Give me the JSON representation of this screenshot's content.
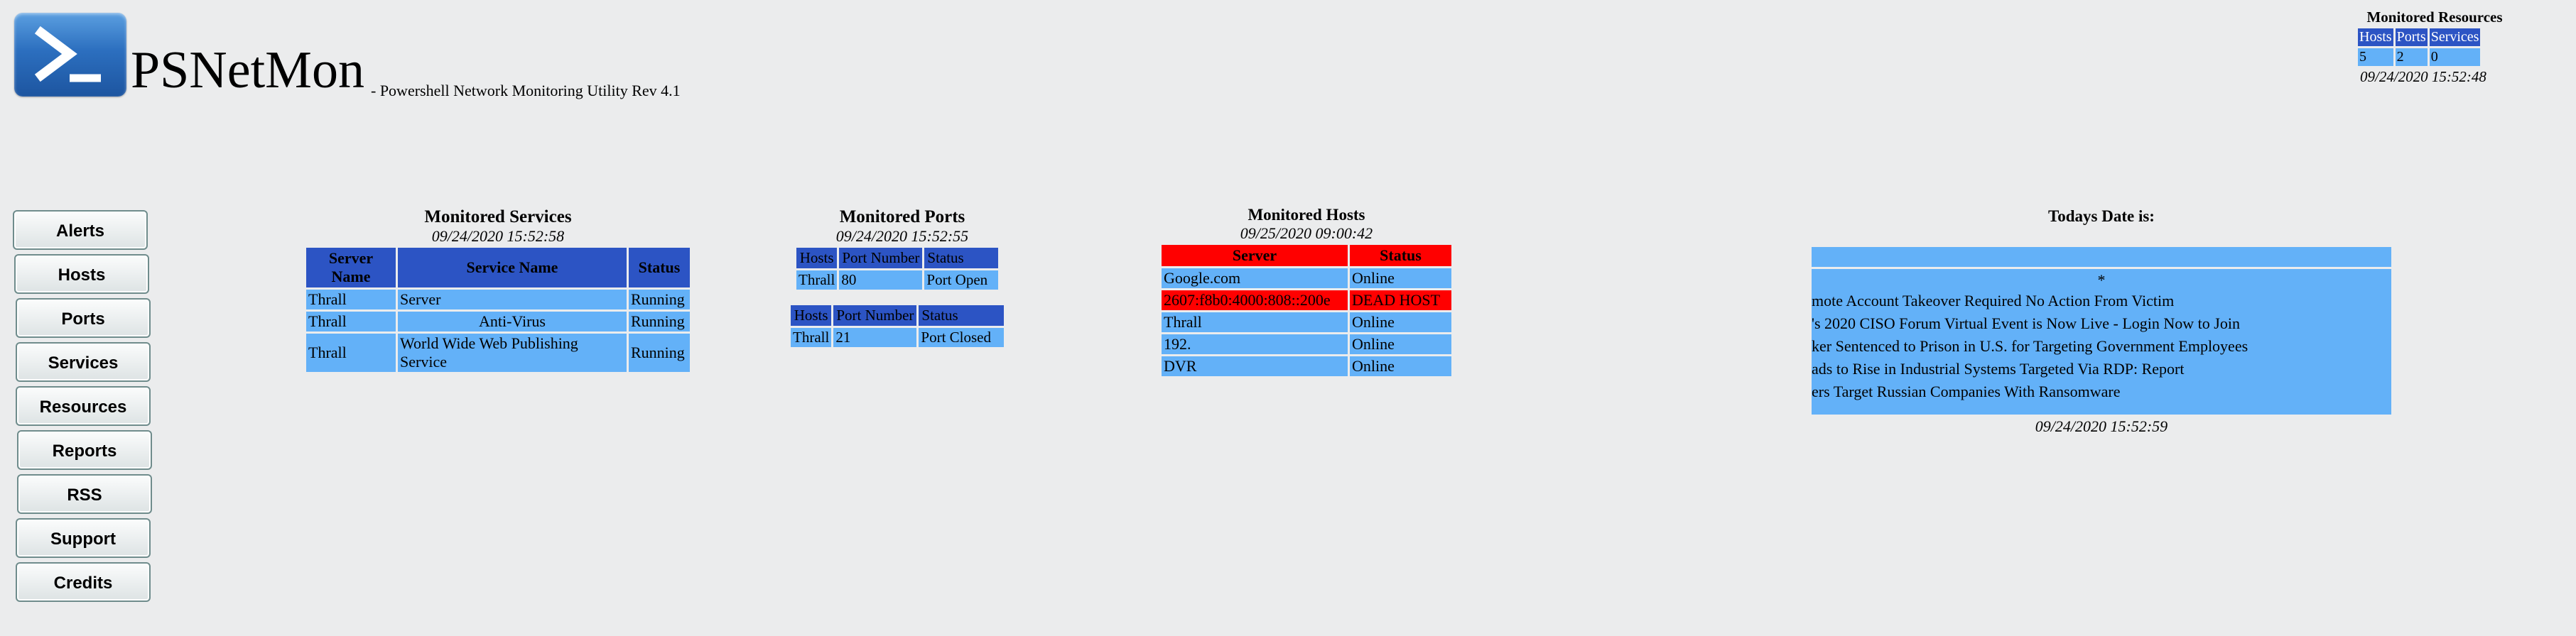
{
  "app": {
    "title": "PSNetMon",
    "subtitle": "- Powershell Network Monitoring Utility Rev 4.1"
  },
  "resources": {
    "title": "Monitored Resources",
    "headers": [
      "Hosts",
      "Ports",
      "Services"
    ],
    "values": [
      "5",
      "2",
      "0"
    ],
    "timestamp": "09/24/2020 15:52:48"
  },
  "nav": {
    "items": [
      "Alerts",
      "Hosts",
      "Ports",
      "Services",
      "Resources",
      "Reports",
      "RSS",
      "Support",
      "Credits"
    ]
  },
  "services": {
    "title": "Monitored Services",
    "timestamp": "09/24/2020 15:52:58",
    "headers": [
      "Server Name",
      "Service Name",
      "Status"
    ],
    "rows": [
      [
        "Thrall",
        "Server",
        "Running"
      ],
      [
        "Thrall",
        "Anti-Virus",
        "Running"
      ],
      [
        "Thrall",
        "World Wide Web Publishing Service",
        "Running"
      ]
    ]
  },
  "ports": {
    "title": "Monitored Ports",
    "timestamp": "09/24/2020 15:52:55",
    "tables": [
      {
        "headers": [
          "Hosts",
          "Port Number",
          "Status"
        ],
        "row": [
          "Thrall",
          "80",
          "Port Open"
        ]
      },
      {
        "headers": [
          "Hosts",
          "Port Number",
          "Status"
        ],
        "row": [
          "Thrall",
          "21",
          "Port Closed"
        ]
      }
    ]
  },
  "hosts": {
    "title": "Monitored Hosts",
    "timestamp": "09/25/2020 09:00:42",
    "headers": [
      "Server",
      "Status"
    ],
    "rows": [
      [
        "Google.com",
        "Online"
      ],
      [
        "2607:f8b0:4000:808::200e",
        "DEAD HOST"
      ],
      [
        "Thrall",
        "Online"
      ],
      [
        "192.",
        "Online"
      ],
      [
        "DVR",
        "Online"
      ]
    ]
  },
  "rss": {
    "title": "Todays Date is:",
    "star": "*",
    "items": [
      "mote Account Takeover Required No Action From Victim",
      "'s 2020 CISO Forum Virtual Event is Now Live - Login Now to Join",
      "ker Sentenced to Prison in U.S. for Targeting Government Employees",
      "ads to Rise in Industrial Systems Targeted Via RDP: Report",
      "ers Target Russian Companies With Ransomware"
    ],
    "timestamp": "09/24/2020 15:52:59"
  },
  "colors": {
    "header_blue": "#2c54c4",
    "cell_blue": "#63b1f8",
    "dead_red": "#ff0000",
    "background": "#ebeced"
  }
}
